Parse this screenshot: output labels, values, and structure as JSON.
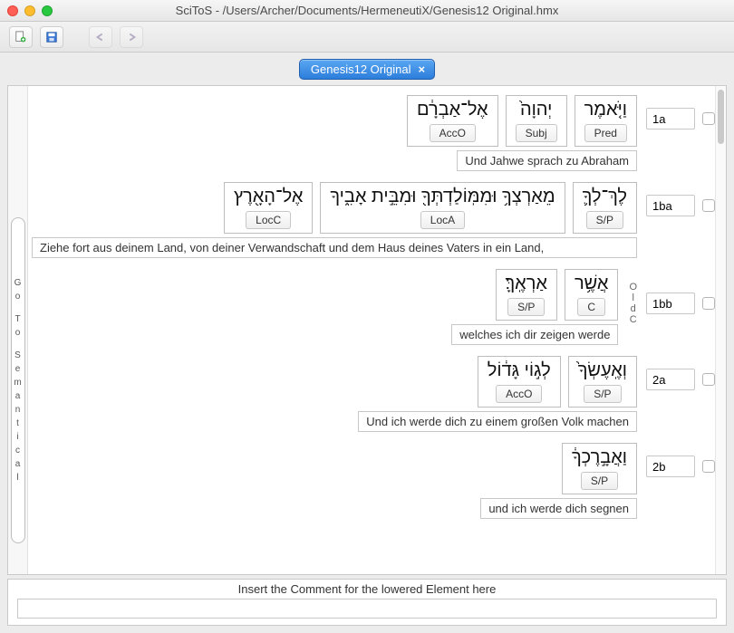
{
  "window": {
    "title": "SciToS - /Users/Archer/Documents/HermeneutiX/Genesis12 Original.hmx"
  },
  "toolbar": {
    "new": "new",
    "save": "save",
    "undo": "undo",
    "redo": "redo"
  },
  "tab": {
    "label": "Genesis12 Original",
    "close": "×"
  },
  "sidebar": {
    "label": "Go To Semantical"
  },
  "clauses": [
    {
      "verse": "1a",
      "translation": "Und Jahwe sprach zu Abraham",
      "units": [
        {
          "heb": "אֶל־אַבְרָ֔ם",
          "tag": "AccO"
        },
        {
          "heb": "יְהוָה֙",
          "tag": "Subj"
        },
        {
          "heb": "וַיֹּ֤אמֶר",
          "tag": "Pred"
        }
      ]
    },
    {
      "verse": "1ba",
      "translation": "Ziehe fort aus deinem Land, von deiner Verwandschaft und dem Haus deines Vaters in ein Land,",
      "units": [
        {
          "heb": "אֶל־הָאָ֖רֶץ",
          "tag": "LocC"
        },
        {
          "heb": "מֵאַרְצְךָ֥ וּמִמּֽוֹלַדְתְּךָ֖ וּמִבֵּ֣ית אָבִ֑יךָ",
          "tag": "LocA"
        },
        {
          "heb": "לֶךְ־לְךָ֛",
          "tag": "S/P"
        }
      ]
    },
    {
      "verse": "1bb",
      "translation": "welches ich dir zeigen werde",
      "note": "OldC",
      "units": [
        {
          "heb": "אַרְאֶֽךָּ׃",
          "tag": "S/P"
        },
        {
          "heb": "אֲשֶׁ֥ר",
          "tag": "C"
        }
      ]
    },
    {
      "verse": "2a",
      "translation": "Und ich werde dich zu einem großen Volk machen",
      "units": [
        {
          "heb": "לְג֣וֹי גָּד֔וֹל",
          "tag": "AccO"
        },
        {
          "heb": "וְאֶֽעֶשְׂךָ֙",
          "tag": "S/P"
        }
      ]
    },
    {
      "verse": "2b",
      "translation": "und ich werde dich segnen",
      "units": [
        {
          "heb": "וַאֲבָ֣רֶכְךָ֔",
          "tag": "S/P"
        }
      ]
    }
  ],
  "comment": {
    "label": "Insert the Comment for the lowered Element here",
    "value": ""
  }
}
